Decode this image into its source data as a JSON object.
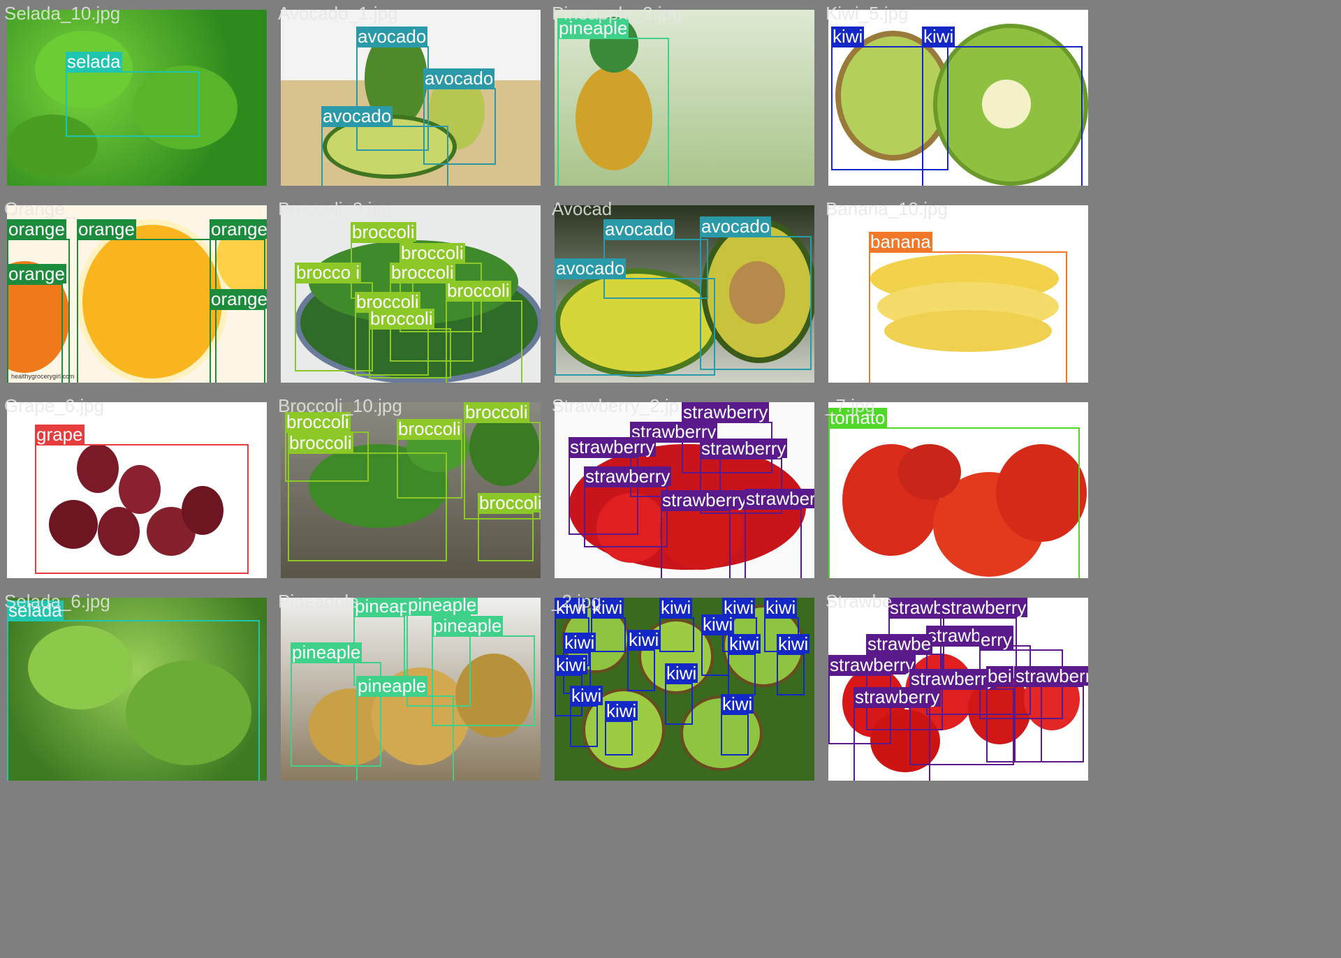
{
  "tiles": [
    {
      "file": "Selada_10.jpg",
      "scene": "lettuce-dense",
      "boxes": [
        {
          "label": "selada",
          "color": "#20c5b0"
        }
      ]
    },
    {
      "file": "Avocado_1.jpg",
      "scene": "avocado-mat",
      "boxes": [
        {
          "label": "avocado",
          "color": "#2a9aa8"
        },
        {
          "label": "avocado",
          "color": "#2a9aa8"
        },
        {
          "label": "avocado",
          "color": "#2a9aa8"
        }
      ]
    },
    {
      "file": "Pineapple_2.jpg",
      "scene": "pineapple-field",
      "boxes": [
        {
          "label": "pineaple",
          "color": "#3fd18a"
        }
      ]
    },
    {
      "file": "Kiwi_5.jpg",
      "scene": "kiwi-halves",
      "boxes": [
        {
          "label": "kiwi",
          "color": "#1428c8"
        },
        {
          "label": "kiwi",
          "color": "#1428c8"
        }
      ]
    },
    {
      "file": "Orange_",
      "scene": "orange-slices",
      "boxes": [
        {
          "label": "orange",
          "color": "#1c8c3c"
        },
        {
          "label": "orange",
          "color": "#1c8c3c"
        },
        {
          "label": "orange",
          "color": "#1c8c3c"
        },
        {
          "label": "orange",
          "color": "#1c8c3c"
        },
        {
          "label": "orange",
          "color": "#1c8c3c"
        }
      ],
      "watermark": "healthygrocerygirl.com"
    },
    {
      "file": "Broccoli_3.jpg",
      "scene": "broccoli-plate",
      "boxes": [
        {
          "label": "broccoli",
          "color": "#8cc828"
        },
        {
          "label": "broccoli",
          "color": "#8cc828"
        },
        {
          "label": "brocco i",
          "color": "#8cc828"
        },
        {
          "label": "broccoli",
          "color": "#8cc828"
        },
        {
          "label": "broccoli",
          "color": "#8cc828"
        },
        {
          "label": "broccoli",
          "color": "#8cc828"
        },
        {
          "label": "broccoli",
          "color": "#8cc828"
        }
      ]
    },
    {
      "file": "Avocad",
      "scene": "avocado-dark",
      "boxes": [
        {
          "label": "avocado",
          "color": "#2a9aa8"
        },
        {
          "label": "avocado",
          "color": "#2a9aa8"
        },
        {
          "label": "avocado",
          "color": "#2a9aa8"
        }
      ]
    },
    {
      "file": "Banana_10.jpg",
      "scene": "banana-bunch",
      "boxes": [
        {
          "label": "banana",
          "color": "#f07828"
        }
      ]
    },
    {
      "file": "Grape_6.jpg",
      "scene": "grapes",
      "boxes": [
        {
          "label": "grape",
          "color": "#e63c3c"
        }
      ]
    },
    {
      "file": "Broccoli_10.jpg",
      "scene": "broccoli-wood",
      "boxes": [
        {
          "label": "broccoli",
          "color": "#8cc828"
        },
        {
          "label": "broccoli",
          "color": "#8cc828"
        },
        {
          "label": "broccoli",
          "color": "#8cc828"
        },
        {
          "label": "broccoli",
          "color": "#8cc828"
        },
        {
          "label": "broccoli",
          "color": "#8cc828"
        }
      ]
    },
    {
      "file": "Strawberry_2.jp",
      "scene": "strawberry-bowl",
      "boxes": [
        {
          "label": "strawberry",
          "color": "#5a1a8c"
        },
        {
          "label": "strawberry",
          "color": "#5a1a8c"
        },
        {
          "label": "strawberry",
          "color": "#5a1a8c"
        },
        {
          "label": "strawberry",
          "color": "#5a1a8c"
        },
        {
          "label": "strawberry",
          "color": "#5a1a8c"
        },
        {
          "label": "strawberry",
          "color": "#5a1a8c"
        },
        {
          "label": "strawberry",
          "color": "#5a1a8c"
        }
      ]
    },
    {
      "file": "_7.jpg",
      "scene": "tomatoes",
      "boxes": [
        {
          "label": "tomato",
          "color": "#50d828"
        }
      ]
    },
    {
      "file": "Selada_6.jpg",
      "scene": "lettuce-leaf",
      "boxes": [
        {
          "label": "selada",
          "color": "#20c5b0"
        }
      ]
    },
    {
      "file": "Pineapple",
      "scene": "pineapple-group",
      "boxes": [
        {
          "label": "pineap",
          "color": "#3fd18a"
        },
        {
          "label": "pineaple",
          "color": "#3fd18a"
        },
        {
          "label": "pineaple",
          "color": "#3fd18a"
        },
        {
          "label": "pineaple",
          "color": "#3fd18a"
        },
        {
          "label": "pineaple",
          "color": "#3fd18a"
        }
      ]
    },
    {
      "file": "_2.jpg",
      "scene": "kiwi-pile",
      "boxes": [
        {
          "label": "kiwi",
          "color": "#1428c8"
        },
        {
          "label": "kiwi",
          "color": "#1428c8"
        },
        {
          "label": "kiwi",
          "color": "#1428c8"
        },
        {
          "label": "kiwi",
          "color": "#1428c8"
        },
        {
          "label": "kiwi",
          "color": "#1428c8"
        },
        {
          "label": "kiwi",
          "color": "#1428c8"
        },
        {
          "label": "kiwi",
          "color": "#1428c8"
        },
        {
          "label": "kiwi",
          "color": "#1428c8"
        },
        {
          "label": "kiwi",
          "color": "#1428c8"
        },
        {
          "label": "kiwi",
          "color": "#1428c8"
        },
        {
          "label": "kiwi",
          "color": "#1428c8"
        },
        {
          "label": "kiwi",
          "color": "#1428c8"
        },
        {
          "label": "kiwi",
          "color": "#1428c8"
        },
        {
          "label": "kiwi",
          "color": "#1428c8"
        },
        {
          "label": "kiwi",
          "color": "#1428c8"
        }
      ]
    },
    {
      "file": "Strawbe",
      "scene": "strawberry-white",
      "boxes": [
        {
          "label": "strawb",
          "color": "#5a1a8c"
        },
        {
          "label": "strawberry",
          "color": "#5a1a8c"
        },
        {
          "label": "strawberry",
          "color": "#5a1a8c"
        },
        {
          "label": "erry",
          "color": "#5a1a8c"
        },
        {
          "label": "strawbe",
          "color": "#5a1a8c"
        },
        {
          "label": "strawberry",
          "color": "#5a1a8c"
        },
        {
          "label": "strawberry",
          "color": "#5a1a8c"
        },
        {
          "label": "bei",
          "color": "#5a1a8c"
        },
        {
          "label": "strawberr",
          "color": "#5a1a8c"
        },
        {
          "label": "strawberry",
          "color": "#5a1a8c"
        }
      ]
    }
  ]
}
